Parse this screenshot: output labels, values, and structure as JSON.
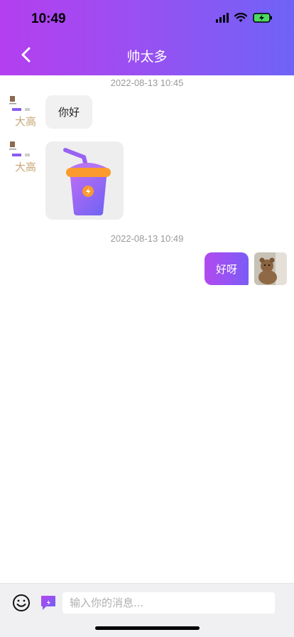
{
  "status_bar": {
    "time": "10:49"
  },
  "header": {
    "title": "帅太多"
  },
  "messages": {
    "timestamp_1": "2022-08-13 10:45",
    "msg_1_text": "你好",
    "timestamp_2": "2022-08-13 10:49",
    "msg_3_text": "好呀"
  },
  "input": {
    "placeholder": "输入你的消息..."
  },
  "colors": {
    "accent_start": "#b43ff0",
    "accent_end": "#6f63f6"
  },
  "icons": [
    "chevron-left-icon",
    "emoji-icon",
    "quick-message-icon",
    "signal-icon",
    "wifi-icon",
    "battery-charging-icon"
  ]
}
